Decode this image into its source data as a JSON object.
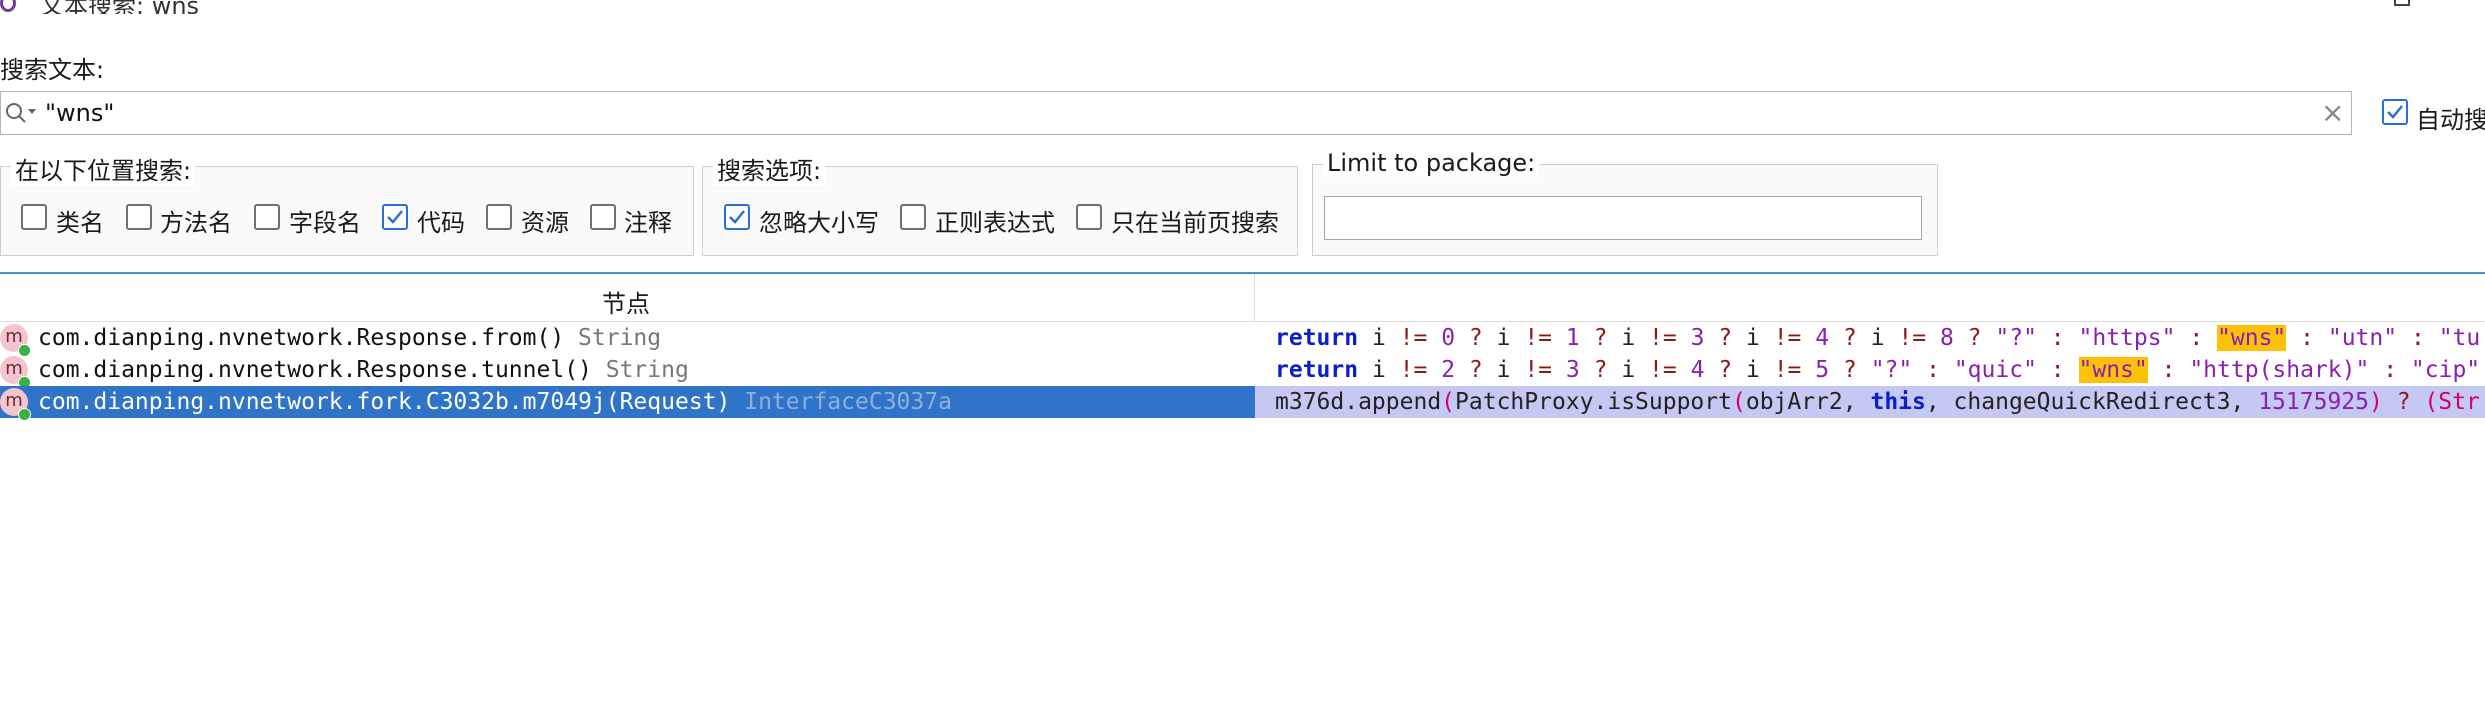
{
  "window": {
    "title": "文本搜索: wns"
  },
  "search": {
    "label": "搜索文本:",
    "value": "\"wns\"",
    "auto_search_label": "自动搜",
    "auto_search_checked": true
  },
  "scope_group": {
    "legend": "在以下位置搜索:",
    "options": [
      {
        "label": "类名",
        "checked": false
      },
      {
        "label": "方法名",
        "checked": false
      },
      {
        "label": "字段名",
        "checked": false
      },
      {
        "label": "代码",
        "checked": true
      },
      {
        "label": "资源",
        "checked": false
      },
      {
        "label": "注释",
        "checked": false
      }
    ]
  },
  "options_group": {
    "legend": "搜索选项:",
    "options": [
      {
        "label": "忽略大小写",
        "checked": true
      },
      {
        "label": "正则表达式",
        "checked": false
      },
      {
        "label": "只在当前页搜索",
        "checked": false
      }
    ]
  },
  "package_group": {
    "legend": "Limit to package:",
    "value": ""
  },
  "results": {
    "column_node": "节点",
    "icon_letter": "m",
    "rows": [
      {
        "node": "com.dianping.nvnetwork.Response.from()",
        "type": "String",
        "selected": false,
        "code": [
          {
            "t": "return",
            "c": "kw"
          },
          {
            "t": " i "
          },
          {
            "t": "!=",
            "c": "op"
          },
          {
            "t": " "
          },
          {
            "t": "0",
            "c": "num"
          },
          {
            "t": " "
          },
          {
            "t": "?",
            "c": "op"
          },
          {
            "t": " i "
          },
          {
            "t": "!=",
            "c": "op"
          },
          {
            "t": " "
          },
          {
            "t": "1",
            "c": "num"
          },
          {
            "t": " "
          },
          {
            "t": "?",
            "c": "op"
          },
          {
            "t": " i "
          },
          {
            "t": "!=",
            "c": "op"
          },
          {
            "t": " "
          },
          {
            "t": "3",
            "c": "num"
          },
          {
            "t": " "
          },
          {
            "t": "?",
            "c": "op"
          },
          {
            "t": " i "
          },
          {
            "t": "!=",
            "c": "op"
          },
          {
            "t": " "
          },
          {
            "t": "4",
            "c": "num"
          },
          {
            "t": " "
          },
          {
            "t": "?",
            "c": "op"
          },
          {
            "t": " i "
          },
          {
            "t": "!=",
            "c": "op"
          },
          {
            "t": " "
          },
          {
            "t": "8",
            "c": "num"
          },
          {
            "t": " "
          },
          {
            "t": "?",
            "c": "op"
          },
          {
            "t": " "
          },
          {
            "t": "\"?\"",
            "c": "str"
          },
          {
            "t": " "
          },
          {
            "t": ":",
            "c": "op"
          },
          {
            "t": " "
          },
          {
            "t": "\"https\"",
            "c": "str"
          },
          {
            "t": " "
          },
          {
            "t": ":",
            "c": "op"
          },
          {
            "t": " "
          },
          {
            "t": "\"wns\"",
            "c": "hl"
          },
          {
            "t": " "
          },
          {
            "t": ":",
            "c": "op"
          },
          {
            "t": " "
          },
          {
            "t": "\"utn\"",
            "c": "str"
          },
          {
            "t": " "
          },
          {
            "t": ":",
            "c": "op"
          },
          {
            "t": " "
          },
          {
            "t": "\"tu",
            "c": "str"
          }
        ]
      },
      {
        "node": "com.dianping.nvnetwork.Response.tunnel()",
        "type": "String",
        "selected": false,
        "code": [
          {
            "t": "return",
            "c": "kw"
          },
          {
            "t": " i "
          },
          {
            "t": "!=",
            "c": "op"
          },
          {
            "t": " "
          },
          {
            "t": "2",
            "c": "num"
          },
          {
            "t": " "
          },
          {
            "t": "?",
            "c": "op"
          },
          {
            "t": " i "
          },
          {
            "t": "!=",
            "c": "op"
          },
          {
            "t": " "
          },
          {
            "t": "3",
            "c": "num"
          },
          {
            "t": " "
          },
          {
            "t": "?",
            "c": "op"
          },
          {
            "t": " i "
          },
          {
            "t": "!=",
            "c": "op"
          },
          {
            "t": " "
          },
          {
            "t": "4",
            "c": "num"
          },
          {
            "t": " "
          },
          {
            "t": "?",
            "c": "op"
          },
          {
            "t": " i "
          },
          {
            "t": "!=",
            "c": "op"
          },
          {
            "t": " "
          },
          {
            "t": "5",
            "c": "num"
          },
          {
            "t": " "
          },
          {
            "t": "?",
            "c": "op"
          },
          {
            "t": " "
          },
          {
            "t": "\"?\"",
            "c": "str"
          },
          {
            "t": " "
          },
          {
            "t": ":",
            "c": "op"
          },
          {
            "t": " "
          },
          {
            "t": "\"quic\"",
            "c": "str"
          },
          {
            "t": " "
          },
          {
            "t": ":",
            "c": "op"
          },
          {
            "t": " "
          },
          {
            "t": "\"wns\"",
            "c": "hl"
          },
          {
            "t": " "
          },
          {
            "t": ":",
            "c": "op"
          },
          {
            "t": " "
          },
          {
            "t": "\"http(shark)\"",
            "c": "str"
          },
          {
            "t": " "
          },
          {
            "t": ":",
            "c": "op"
          },
          {
            "t": " "
          },
          {
            "t": "\"cip\"",
            "c": "str"
          }
        ]
      },
      {
        "node": "com.dianping.nvnetwork.fork.C3032b.m7049j(Request)",
        "type": "InterfaceC3037a",
        "selected": true,
        "code": [
          {
            "t": "m376d.append"
          },
          {
            "t": "(",
            "c": "par"
          },
          {
            "t": "PatchProxy.isSupport"
          },
          {
            "t": "(",
            "c": "par"
          },
          {
            "t": "objArr2, "
          },
          {
            "t": "this",
            "c": "kw"
          },
          {
            "t": ", changeQuickRedirect3, "
          },
          {
            "t": "15175925",
            "c": "num"
          },
          {
            "t": ")",
            "c": "par"
          },
          {
            "t": " "
          },
          {
            "t": "?",
            "c": "op"
          },
          {
            "t": " "
          },
          {
            "t": "(Str",
            "c": "par"
          }
        ]
      }
    ]
  }
}
